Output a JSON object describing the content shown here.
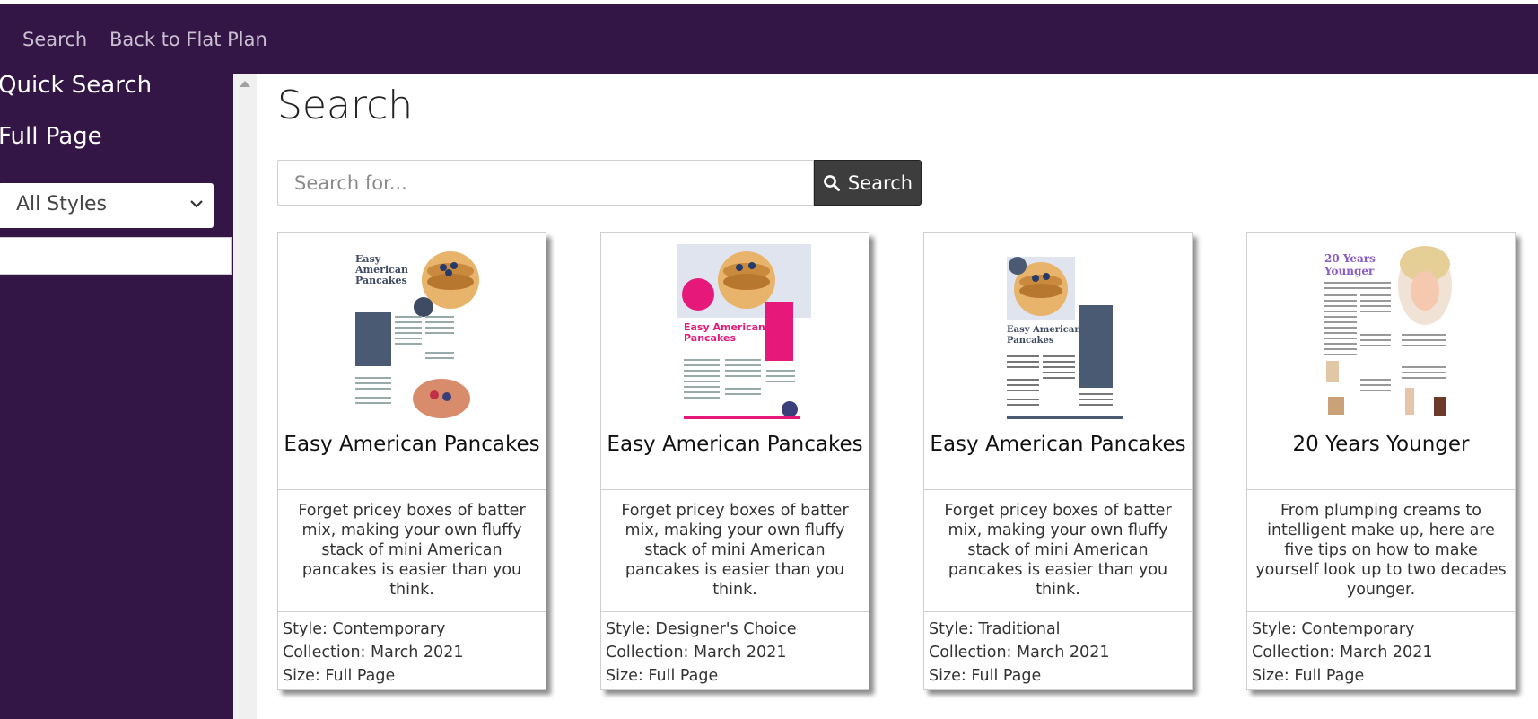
{
  "nav": {
    "search_label": "Search",
    "back_label": "Back to Flat Plan"
  },
  "sidebar": {
    "quick_search_label": "Quick Search",
    "full_page_label": "Full Page",
    "style_select_value": "All Styles",
    "filter_input_value": ""
  },
  "main": {
    "title": "Search",
    "search_placeholder": "Search for...",
    "search_button_label": "Search"
  },
  "colors": {
    "brand": "#341646",
    "button": "#3d3d3d",
    "accent_pink": "#e6197a",
    "accent_purple": "#8a5cc4",
    "slate": "#4a5a73"
  },
  "results": [
    {
      "title": "Easy American Pancakes",
      "description": "Forget pricey boxes of batter mix, making your own fluffy stack of mini American pancakes is easier than you think.",
      "style": "Style: Contemporary",
      "collection": "Collection: March 2021",
      "size": "Size: Full Page",
      "thumb_text": "Easy American Pancakes"
    },
    {
      "title": "Easy American Pancakes",
      "description": "Forget pricey boxes of batter mix, making your own fluffy stack of mini American pancakes is easier than you think.",
      "style": "Style: Designer's Choice",
      "collection": "Collection: March 2021",
      "size": "Size: Full Page",
      "thumb_text": "Easy American Pancakes"
    },
    {
      "title": "Easy American Pancakes",
      "description": "Forget pricey boxes of batter mix, making your own fluffy stack of mini American pancakes is easier than you think.",
      "style": "Style: Traditional",
      "collection": "Collection: March 2021",
      "size": "Size: Full Page",
      "thumb_text": "Easy American Pancakes"
    },
    {
      "title": "20 Years Younger",
      "description": "From plumping creams to intelligent make up, here are five tips on how to make yourself look up to two decades younger.",
      "style": "Style: Contemporary",
      "collection": "Collection: March 2021",
      "size": "Size: Full Page",
      "thumb_text": "20 Years Younger"
    }
  ]
}
